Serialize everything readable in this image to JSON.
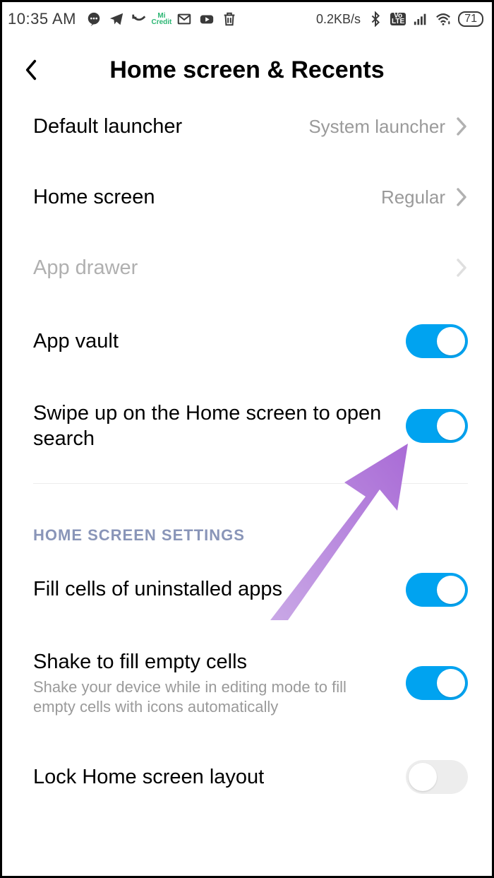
{
  "statusbar": {
    "time": "10:35 AM",
    "data_rate": "0.2KB/s",
    "volte": "Vo\nLTE",
    "battery": "71"
  },
  "header": {
    "title": "Home screen & Recents"
  },
  "rows": {
    "default_launcher": {
      "label": "Default launcher",
      "value": "System launcher"
    },
    "home_screen": {
      "label": "Home screen",
      "value": "Regular"
    },
    "app_drawer": {
      "label": "App drawer"
    },
    "app_vault": {
      "label": "App vault"
    },
    "swipe_search": {
      "label": "Swipe up on the Home screen to open search"
    },
    "fill_cells": {
      "label": "Fill cells of uninstalled apps"
    },
    "shake_fill": {
      "label": "Shake to fill empty cells",
      "sub": "Shake your device while in editing mode to fill empty cells with icons automatically"
    },
    "lock_layout": {
      "label": "Lock Home screen layout"
    }
  },
  "section": {
    "home_settings": "HOME SCREEN SETTINGS"
  },
  "colors": {
    "accent": "#00a3f0",
    "arrow": "#b57ce0"
  }
}
